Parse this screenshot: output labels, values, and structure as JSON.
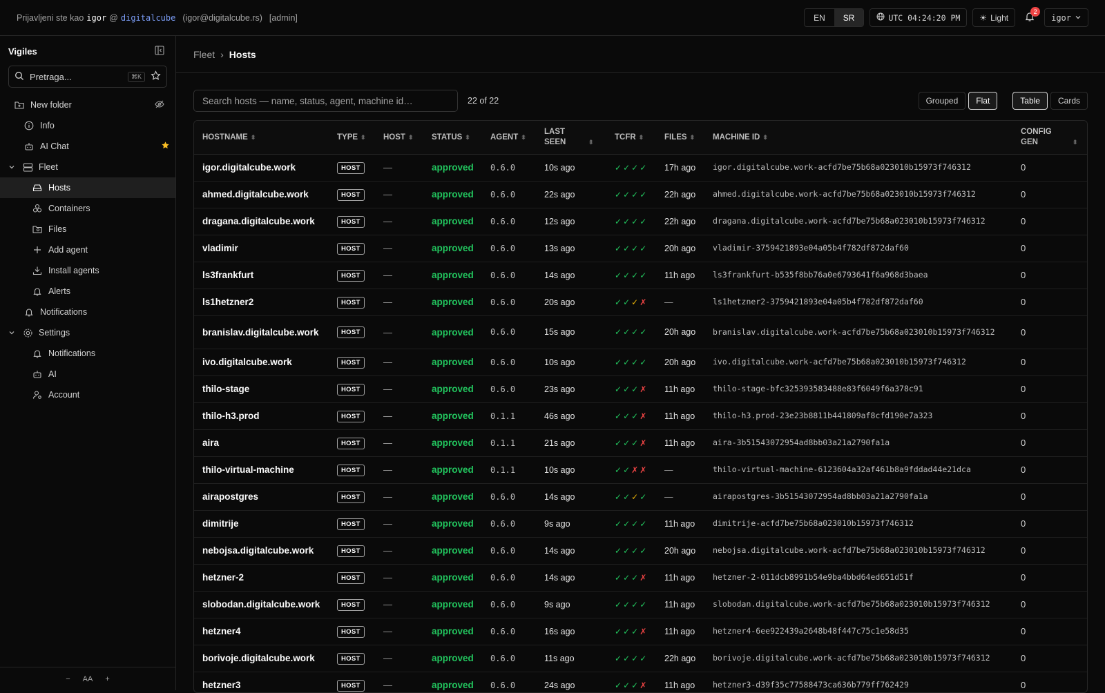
{
  "topbar": {
    "login_prefix": "Prijavljeni ste kao",
    "user": "igor",
    "at": "@",
    "org": "digitalcube",
    "email": "(igor@digitalcube.rs)",
    "role": "[admin]",
    "lang_en": "EN",
    "lang_sr": "SR",
    "clock": "UTC 04:24:20 PM",
    "theme": "Light",
    "notif_count": "2",
    "user_menu": "igor"
  },
  "sidebar": {
    "title": "Vigiles",
    "search_placeholder": "Pretraga...",
    "search_kbd": "⌘K",
    "items": {
      "new_folder": "New folder",
      "info": "Info",
      "ai_chat": "AI Chat",
      "fleet": "Fleet",
      "hosts": "Hosts",
      "containers": "Containers",
      "files": "Files",
      "add_agent": "Add agent",
      "install_agents": "Install agents",
      "alerts": "Alerts",
      "notifications": "Notifications",
      "settings": "Settings",
      "settings_notifications": "Notifications",
      "settings_ai": "AI",
      "account": "Account"
    },
    "font_minus": "−",
    "font_label": "AA",
    "font_plus": "+"
  },
  "main": {
    "crumb_fleet": "Fleet",
    "crumb_sep": "›",
    "crumb_hosts": "Hosts",
    "search_placeholder": "Search hosts — name, status, agent, machine id…",
    "count": "22 of 22",
    "btn_grouped": "Grouped",
    "btn_flat": "Flat",
    "btn_table": "Table",
    "btn_cards": "Cards",
    "columns": {
      "hostname": "HOSTNAME",
      "type": "TYPE",
      "host": "HOST",
      "status": "STATUS",
      "agent": "AGENT",
      "last_seen": "LAST SEEN",
      "tcfr": "TCFR",
      "files": "FILES",
      "machine_id": "MACHINE ID",
      "config_gen": "CONFIG GEN"
    }
  },
  "rows": [
    {
      "hostname": "igor.digitalcube.work",
      "type": "HOST",
      "host": "—",
      "status": "approved",
      "agent": "0.6.0",
      "seen": "10s ago",
      "tcfr": [
        "ok",
        "ok",
        "ok",
        "ok"
      ],
      "files": "17h ago",
      "mid": "igor.digitalcube.work-acfd7be75b68a023010b15973f746312",
      "cfg": "0"
    },
    {
      "hostname": "ahmed.digitalcube.work",
      "type": "HOST",
      "host": "—",
      "status": "approved",
      "agent": "0.6.0",
      "seen": "22s ago",
      "tcfr": [
        "ok",
        "ok",
        "ok",
        "ok"
      ],
      "files": "22h ago",
      "mid": "ahmed.digitalcube.work-acfd7be75b68a023010b15973f746312",
      "cfg": "0"
    },
    {
      "hostname": "dragana.digitalcube.work",
      "type": "HOST",
      "host": "—",
      "status": "approved",
      "agent": "0.6.0",
      "seen": "12s ago",
      "tcfr": [
        "ok",
        "ok",
        "ok",
        "ok"
      ],
      "files": "22h ago",
      "mid": "dragana.digitalcube.work-acfd7be75b68a023010b15973f746312",
      "cfg": "0"
    },
    {
      "hostname": "vladimir",
      "type": "HOST",
      "host": "—",
      "status": "approved",
      "agent": "0.6.0",
      "seen": "13s ago",
      "tcfr": [
        "ok",
        "ok",
        "ok",
        "ok"
      ],
      "files": "20h ago",
      "mid": "vladimir-3759421893e04a05b4f782df872daf60",
      "cfg": "0"
    },
    {
      "hostname": "ls3frankfurt",
      "type": "HOST",
      "host": "—",
      "status": "approved",
      "agent": "0.6.0",
      "seen": "14s ago",
      "tcfr": [
        "ok",
        "ok",
        "ok",
        "ok"
      ],
      "files": "11h ago",
      "mid": "ls3frankfurt-b535f8bb76a0e6793641f6a968d3baea",
      "cfg": "0"
    },
    {
      "hostname": "ls1hetzner2",
      "type": "HOST",
      "host": "—",
      "status": "approved",
      "agent": "0.6.0",
      "seen": "20s ago",
      "tcfr": [
        "ok",
        "ok",
        "warn",
        "bad"
      ],
      "files": "—",
      "mid": "ls1hetzner2-3759421893e04a05b4f782df872daf60",
      "cfg": "0"
    },
    {
      "hostname": "branislav.digitalcube.work",
      "type": "HOST",
      "host": "—",
      "status": "approved",
      "agent": "0.6.0",
      "seen": "15s ago",
      "tcfr": [
        "ok",
        "ok",
        "ok",
        "ok"
      ],
      "files": "20h ago",
      "mid": "branislav.digitalcube.work-acfd7be75b68a023010b15973f746312",
      "cfg": "0",
      "tall": true
    },
    {
      "hostname": "ivo.digitalcube.work",
      "type": "HOST",
      "host": "—",
      "status": "approved",
      "agent": "0.6.0",
      "seen": "10s ago",
      "tcfr": [
        "ok",
        "ok",
        "ok",
        "ok"
      ],
      "files": "20h ago",
      "mid": "ivo.digitalcube.work-acfd7be75b68a023010b15973f746312",
      "cfg": "0"
    },
    {
      "hostname": "thilo-stage",
      "type": "HOST",
      "host": "—",
      "status": "approved",
      "agent": "0.6.0",
      "seen": "23s ago",
      "tcfr": [
        "ok",
        "ok",
        "ok",
        "bad"
      ],
      "files": "11h ago",
      "mid": "thilo-stage-bfc325393583488e83f6049f6a378c91",
      "cfg": "0"
    },
    {
      "hostname": "thilo-h3.prod",
      "type": "HOST",
      "host": "—",
      "status": "approved",
      "agent": "0.1.1",
      "seen": "46s ago",
      "tcfr": [
        "ok",
        "ok",
        "ok",
        "bad"
      ],
      "files": "11h ago",
      "mid": "thilo-h3.prod-23e23b8811b441809af8cfd190e7a323",
      "cfg": "0"
    },
    {
      "hostname": "aira",
      "type": "HOST",
      "host": "—",
      "status": "approved",
      "agent": "0.1.1",
      "seen": "21s ago",
      "tcfr": [
        "ok",
        "ok",
        "ok",
        "bad"
      ],
      "files": "11h ago",
      "mid": "aira-3b51543072954ad8bb03a21a2790fa1a",
      "cfg": "0"
    },
    {
      "hostname": "thilo-virtual-machine",
      "type": "HOST",
      "host": "—",
      "status": "approved",
      "agent": "0.1.1",
      "seen": "10s ago",
      "tcfr": [
        "ok",
        "ok",
        "bad",
        "bad"
      ],
      "files": "—",
      "mid": "thilo-virtual-machine-6123604a32af461b8a9fddad44e21dca",
      "cfg": "0"
    },
    {
      "hostname": "airapostgres",
      "type": "HOST",
      "host": "—",
      "status": "approved",
      "agent": "0.6.0",
      "seen": "14s ago",
      "tcfr": [
        "ok",
        "ok",
        "warn",
        "ok"
      ],
      "files": "—",
      "mid": "airapostgres-3b51543072954ad8bb03a21a2790fa1a",
      "cfg": "0"
    },
    {
      "hostname": "dimitrije",
      "type": "HOST",
      "host": "—",
      "status": "approved",
      "agent": "0.6.0",
      "seen": "9s ago",
      "tcfr": [
        "ok",
        "ok",
        "ok",
        "ok"
      ],
      "files": "11h ago",
      "mid": "dimitrije-acfd7be75b68a023010b15973f746312",
      "cfg": "0"
    },
    {
      "hostname": "nebojsa.digitalcube.work",
      "type": "HOST",
      "host": "—",
      "status": "approved",
      "agent": "0.6.0",
      "seen": "14s ago",
      "tcfr": [
        "ok",
        "ok",
        "ok",
        "ok"
      ],
      "files": "20h ago",
      "mid": "nebojsa.digitalcube.work-acfd7be75b68a023010b15973f746312",
      "cfg": "0"
    },
    {
      "hostname": "hetzner-2",
      "type": "HOST",
      "host": "—",
      "status": "approved",
      "agent": "0.6.0",
      "seen": "14s ago",
      "tcfr": [
        "ok",
        "ok",
        "ok",
        "bad"
      ],
      "files": "11h ago",
      "mid": "hetzner-2-011dcb8991b54e9ba4bbd64ed651d51f",
      "cfg": "0"
    },
    {
      "hostname": "slobodan.digitalcube.work",
      "type": "HOST",
      "host": "—",
      "status": "approved",
      "agent": "0.6.0",
      "seen": "9s ago",
      "tcfr": [
        "ok",
        "ok",
        "ok",
        "ok"
      ],
      "files": "11h ago",
      "mid": "slobodan.digitalcube.work-acfd7be75b68a023010b15973f746312",
      "cfg": "0"
    },
    {
      "hostname": "hetzner4",
      "type": "HOST",
      "host": "—",
      "status": "approved",
      "agent": "0.6.0",
      "seen": "16s ago",
      "tcfr": [
        "ok",
        "ok",
        "ok",
        "bad"
      ],
      "files": "11h ago",
      "mid": "hetzner4-6ee922439a2648b48f447c75c1e58d35",
      "cfg": "0"
    },
    {
      "hostname": "borivoje.digitalcube.work",
      "type": "HOST",
      "host": "—",
      "status": "approved",
      "agent": "0.6.0",
      "seen": "11s ago",
      "tcfr": [
        "ok",
        "ok",
        "ok",
        "ok"
      ],
      "files": "22h ago",
      "mid": "borivoje.digitalcube.work-acfd7be75b68a023010b15973f746312",
      "cfg": "0"
    },
    {
      "hostname": "hetzner3",
      "type": "HOST",
      "host": "—",
      "status": "approved",
      "agent": "0.6.0",
      "seen": "24s ago",
      "tcfr": [
        "ok",
        "ok",
        "ok",
        "bad"
      ],
      "files": "11h ago",
      "mid": "hetzner3-d39f35c77588473ca636b779ff762429",
      "cfg": "0"
    }
  ],
  "colors": {
    "approved": "#22c55e",
    "ok": "#22c55e",
    "warn": "#eab308",
    "bad": "#ef4444",
    "accent": "#7c9ef8"
  }
}
